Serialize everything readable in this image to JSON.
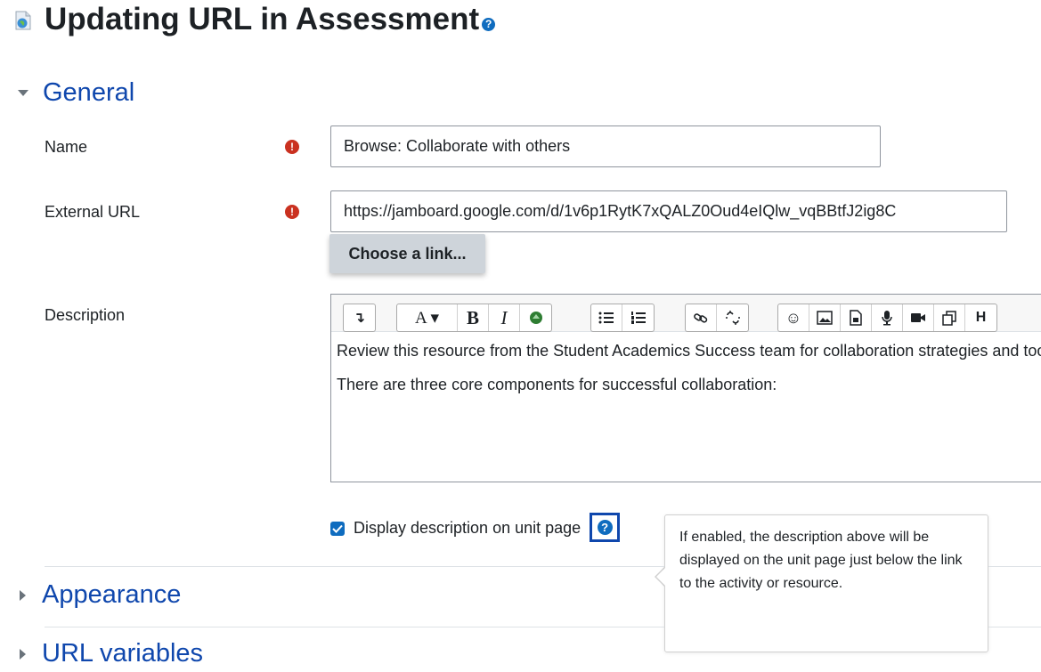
{
  "page": {
    "title": "Updating URL in Assessment",
    "title_help": "?"
  },
  "sections": {
    "general": "General",
    "appearance": "Appearance",
    "url_variables": "URL variables"
  },
  "form": {
    "name_label": "Name",
    "name_value": "Browse: Collaborate with others",
    "url_label": "External URL",
    "url_value": "https://jamboard.google.com/d/1v6p1RytK7xQALZ0Oud4eIQlw_vqBBtfJ2ig8C",
    "required_icon": "!",
    "choose_link_label": "Choose a link...",
    "description_label": "Description",
    "description_paragraphs": [
      "Review this resource from the Student Academics Success team for collaboration strategies and tools.",
      "There are three core components for successful collaboration:"
    ],
    "display_checkbox_label": "Display description on unit page",
    "display_checkbox_checked": true,
    "help_glyph": "?"
  },
  "toolbar": {
    "collapse": "↴",
    "font": "A ▾",
    "bold": "B",
    "italic": "I",
    "unordered_list": "☰",
    "ordered_list": "☷",
    "link": "⚭",
    "unlink": "⛓",
    "emoji": "☺",
    "more": "H"
  },
  "popover": {
    "text": "If enabled, the description above will be displayed on the unit page just below the link to the activity or resource."
  },
  "colors": {
    "accent": "#0f6cbf",
    "section_link": "#0f47ad",
    "required": "#ca3120"
  }
}
